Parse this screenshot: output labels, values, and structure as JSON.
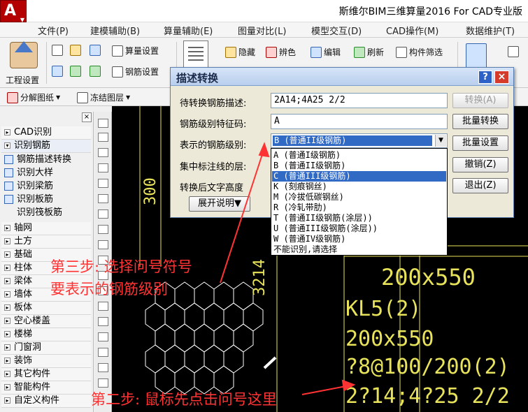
{
  "window": {
    "title": "斯维尔BIM三维算量2016 For CAD专业版",
    "app_button": "A"
  },
  "menu": [
    "文件(P)",
    "建模辅助(B)",
    "算量辅助(E)",
    "图量对比(L)",
    "模型交互(D)",
    "CAD操作(M)",
    "数据维护(T)"
  ],
  "ribbon": {
    "project_settings": "工程设置",
    "quantity_settings": "算量设置",
    "rebar_settings": "钢筋设置",
    "hide": "隐藏",
    "color_identify": "辨色",
    "edit": "编辑",
    "refresh": "刷新",
    "filter": "构件筛选"
  },
  "toolbar2": {
    "split_drawing": "分解图纸",
    "freeze_layer": "冻结图层"
  },
  "left_panel": {
    "close": "×",
    "groups": [
      "CAD识别",
      "识别钢筋"
    ],
    "rebar_items": [
      "钢筋描述转换",
      "识别大样",
      "识别梁筋",
      "识别板筋",
      "识别筏板筋"
    ],
    "categories": [
      "轴网",
      "土方",
      "基础",
      "柱体",
      "梁体",
      "墙体",
      "板体",
      "空心楼盖",
      "楼梯",
      "门窗洞",
      "装饰",
      "其它构件",
      "智能构件",
      "自定义构件"
    ]
  },
  "dialog": {
    "title": "描述转换",
    "help": "?",
    "close": "×",
    "fields": {
      "desc_label": "待转换钢筋描述:",
      "desc_value": "2A14;4A25 2/2",
      "code_label": "钢筋级别特征码:",
      "code_value": "A",
      "grade_label": "表示的钢筋级别:",
      "grade_value": "B (普通II级钢筋)",
      "layer_label": "集中标注线的层:",
      "height_label": "转换后文字高度"
    },
    "buttons": {
      "convert": "转换(A)",
      "batch_convert": "批量转换",
      "batch_settings": "批量设置",
      "undo": "撤销(Z)",
      "exit": "退出(Z)",
      "expand": "展开说明▼"
    },
    "dropdown_options": [
      "A (普通I级钢筋)",
      "B (普通II级钢筋)",
      "C (普通III级钢筋)",
      "K (刻痕钢丝)",
      "M (冷拔低碳钢丝)",
      "R (冷轧带肋)",
      "T (普通II级钢筋(涂层))",
      "U (普通III级钢筋(涂层))",
      "W (普通IV级钢筋)",
      "不能识别,请选择"
    ],
    "selected_option_index": 2
  },
  "cad_text": {
    "dim_300": "300",
    "dim_3214": "3214",
    "beam_size_1": "200x550",
    "beam_id": "KL5(2)",
    "beam_size_2": "200x550",
    "stirrup": "?8@100/200(2)",
    "rebar": "2?14;4?25 2/2"
  },
  "annotations": {
    "step3_line1": "第三步: 选择问号符号",
    "step3_line2": "要表示的钢筋级别",
    "step2": "第二步: 鼠标先点击问号这里"
  },
  "colors": {
    "annotation": "#ff3333",
    "cad_text": "#e8e35a",
    "selection": "#316ac5"
  }
}
